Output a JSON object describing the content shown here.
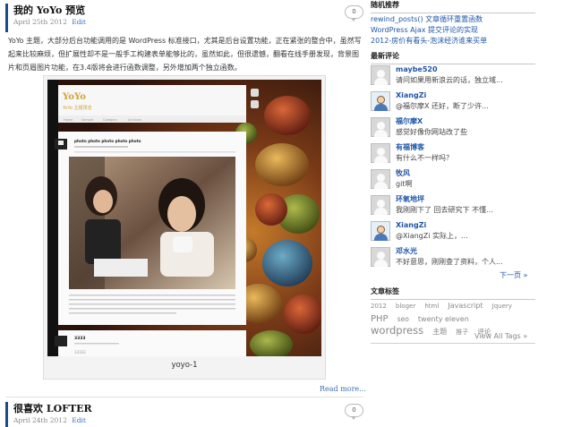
{
  "posts": [
    {
      "title": "我的 YoYo 预览",
      "date": "April 25th 2012",
      "edit": "Edit",
      "comments": "0",
      "body": "YoYo 主题，大部分后台功能调用的是 WordPress 标准接口，尤其是后台设置功能，正在紧张的整合中，虽然写起来比较麻烦，但扩展性却不是一般手工构建表单能够比的，虽然如此，但很遗憾，翻看在线手册发现，背景图片和页眉图片功能，在3.4版将会进行函数调整，另外增加两个独立函数。",
      "figure": {
        "caption": "yoyo-1",
        "preview": {
          "site_title": "YoYo",
          "site_tagline": "YoYo 主题预览",
          "nav_items": [
            "Home",
            "Sample",
            "Category",
            "Archives"
          ],
          "post_title": "photo photo photo photo photo",
          "footer_title": "3333",
          "footer_bottom": "33333"
        }
      },
      "read_more": "Read more..."
    },
    {
      "title": "很喜欢 LOFTER",
      "date": "April 24th 2012",
      "edit": "Edit",
      "comments": "0"
    }
  ],
  "sidebar": {
    "random_title": "随机推荐",
    "random_posts": [
      "rewind_posts() 文章循环重置函数",
      "WordPress Ajax 提交评论的实现",
      "2012-房价有看头-泡沫经济谁来买单"
    ],
    "recent_title": "最新评论",
    "recent_comments": [
      {
        "name": "maybe520",
        "text": "请问如果用新浪云的话，独立域...",
        "avatar": "generic"
      },
      {
        "name": "XiangZi",
        "text": "@福尔摩X 还好，断了少许...",
        "avatar": "cartoon"
      },
      {
        "name": "福尔摩X",
        "text": "感觉好像你网站改了些",
        "avatar": "generic"
      },
      {
        "name": "有福博客",
        "text": "有什么不一样吗？",
        "avatar": "generic"
      },
      {
        "name": "牧风",
        "text": "git啊",
        "avatar": "generic"
      },
      {
        "name": "环氧地坪",
        "text": "我刚刚下了 回去研究下 不懂...",
        "avatar": "generic"
      },
      {
        "name": "XiangZi",
        "text": "@XiangZi 实际上，...",
        "avatar": "cartoon"
      },
      {
        "name": "邓水光",
        "text": "不好意思，刚刚查了资料，个人...",
        "avatar": "generic"
      }
    ],
    "next_page": "下一页 »",
    "tags_title": "文章标签",
    "tags": [
      {
        "label": "2012",
        "size": 7
      },
      {
        "label": "bloger",
        "size": 7
      },
      {
        "label": "html",
        "size": 7
      },
      {
        "label": "Javascript",
        "size": 8
      },
      {
        "label": "Jquery",
        "size": 7
      },
      {
        "label": "PHP",
        "size": 10
      },
      {
        "label": "seo",
        "size": 7.5
      },
      {
        "label": "twenty eleven",
        "size": 8
      },
      {
        "label": "wordpress",
        "size": 11.5
      },
      {
        "label": "主题",
        "size": 8
      },
      {
        "label": "推子",
        "size": 7
      },
      {
        "label": "评论",
        "size": 7.5
      }
    ],
    "view_all": "View All Tags »"
  },
  "colors": {
    "link": "#1f56a8",
    "accent_bar": "#1a4b8c",
    "meta_gray": "#8a8a8a"
  }
}
